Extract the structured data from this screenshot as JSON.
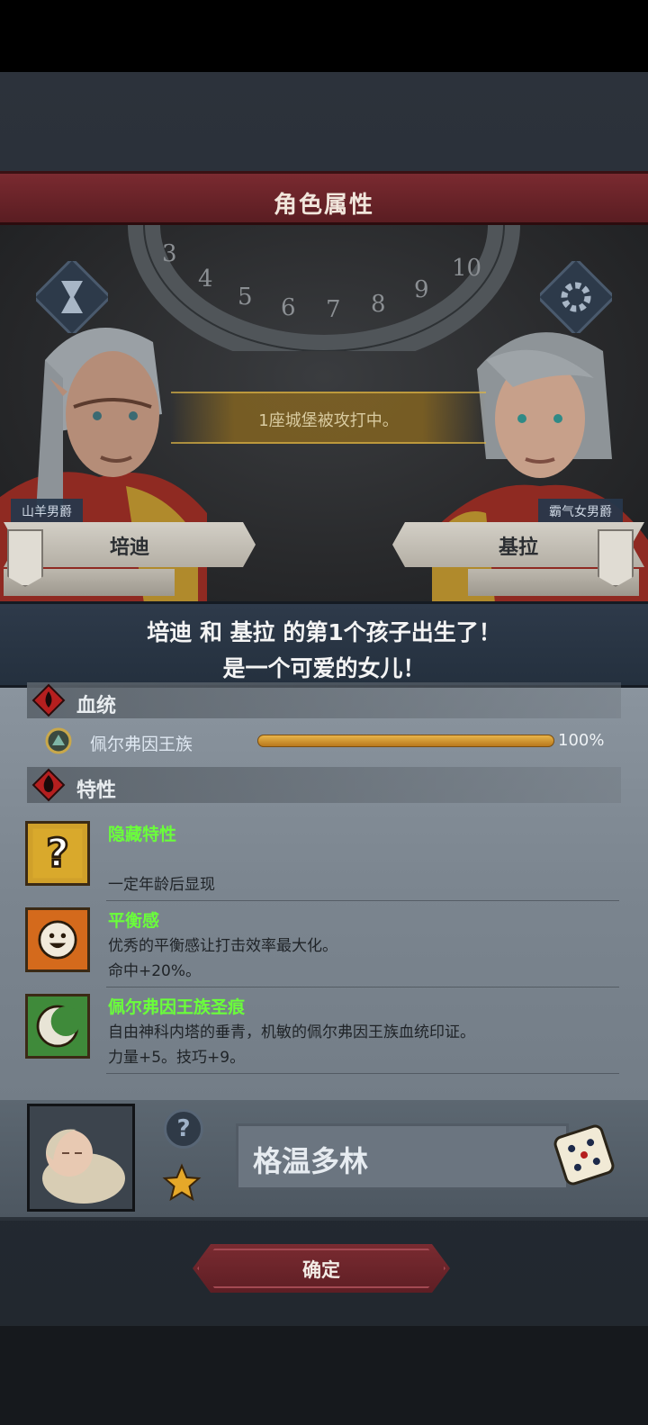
{
  "screen": {
    "title": "角色属性",
    "event_message": "1座城堡被攻打中。"
  },
  "parents": {
    "father": {
      "name": "培迪",
      "title": "山羊男爵"
    },
    "mother": {
      "name": "基拉",
      "title": "霸气女男爵"
    }
  },
  "announcement": {
    "line1": "培迪 和 基拉 的第1个孩子出生了！",
    "line2": "是一个可爱的女儿！"
  },
  "lineage": {
    "header": "血统",
    "entries": [
      {
        "name": "佩尔弗因王族",
        "percent_text": "100%",
        "percent": 100
      }
    ]
  },
  "traits": {
    "header": "特性",
    "items": [
      {
        "name": "隐藏特性",
        "desc1": "一定年龄后显现",
        "desc2": "",
        "icon": "question-mark-icon"
      },
      {
        "name": "平衡感",
        "desc1": "优秀的平衡感让打击效率最大化。",
        "desc2": "命中+20%。",
        "icon": "smiley-face-icon"
      },
      {
        "name": "佩尔弗因王族圣痕",
        "desc1": "自由神科内塔的垂青，机敏的佩尔弗因王族血统印证。",
        "desc2": "力量+5。技巧+9。",
        "icon": "crescent-swirl-icon"
      }
    ]
  },
  "child": {
    "name": "格温多林",
    "help_glyph": "?"
  },
  "confirm_label": "确定",
  "colors": {
    "title_banner": "#6b2329",
    "trait_name": "#6aff3a",
    "lineage_bar": "#d89a2e",
    "announce_bg": "#2a3545"
  }
}
